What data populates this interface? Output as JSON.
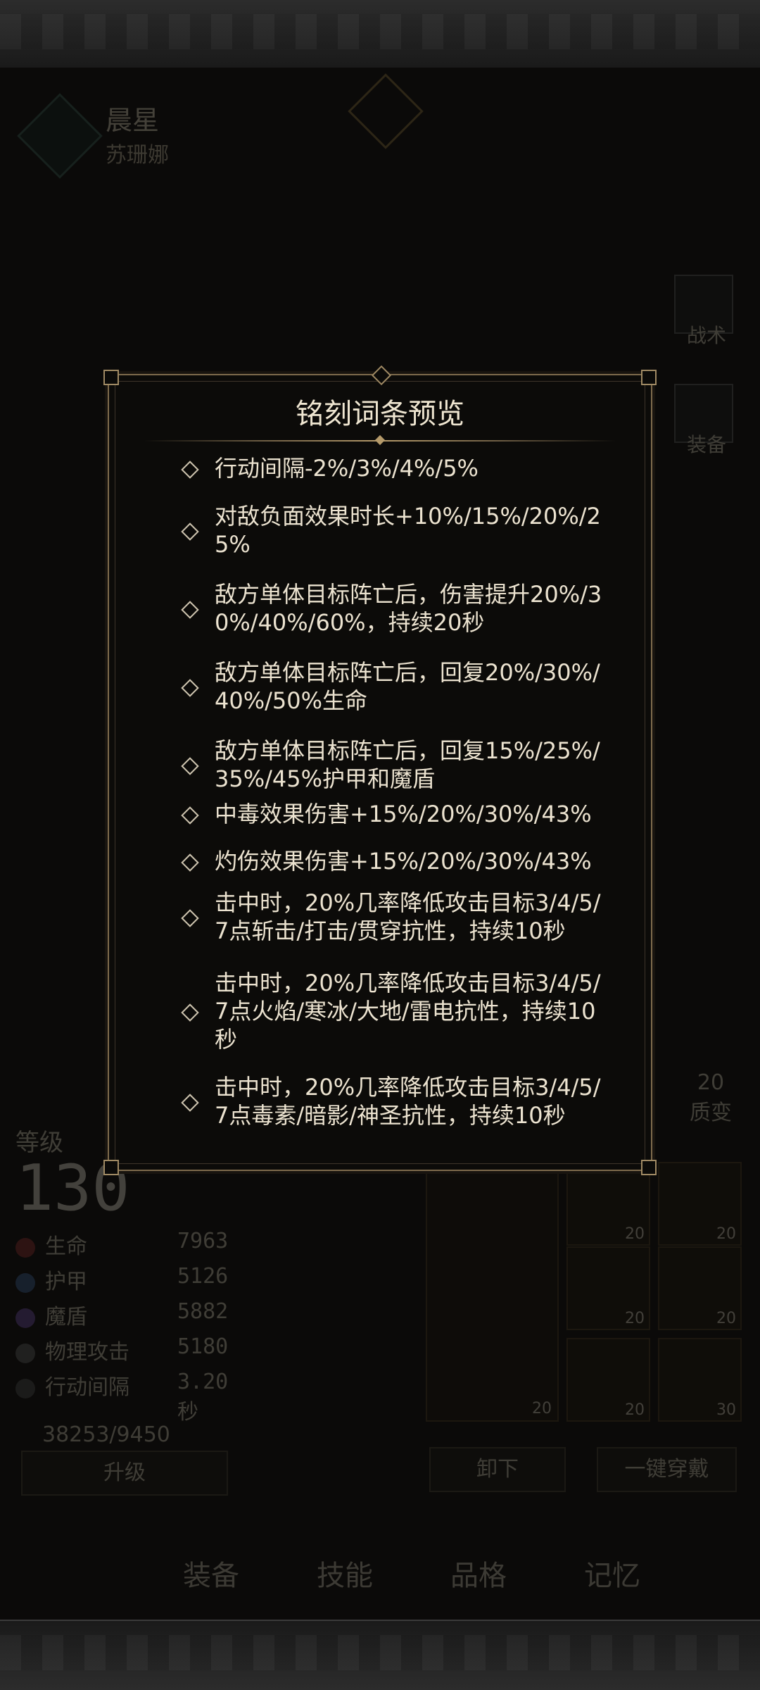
{
  "background": {
    "hero": {
      "title": "晨星",
      "name": "苏珊娜"
    },
    "side_buttons": [
      "战术",
      "装备"
    ],
    "stats": {
      "level_label": "等级",
      "level": "130",
      "rows": [
        {
          "label": "生命",
          "value": "7963"
        },
        {
          "label": "护甲",
          "value": "5126"
        },
        {
          "label": "魔盾",
          "value": "5882"
        },
        {
          "label": "物理攻击",
          "value": "5180"
        },
        {
          "label": "行动间隔",
          "value": "3.20秒"
        }
      ],
      "exp": "38253/9450"
    },
    "buttons": {
      "upgrade": "升级",
      "unequip": "卸下",
      "equip_all": "一键穿戴"
    },
    "quality": {
      "value": "20",
      "label": "质变"
    },
    "slots": [
      "20",
      "20",
      "20",
      "20",
      "20",
      "20",
      "30"
    ],
    "tabs": [
      "装备",
      "技能",
      "品格",
      "记忆"
    ]
  },
  "modal": {
    "title": "铭刻词条预览",
    "items": [
      "行动间隔-2%/3%/4%/5%",
      "对敌负面效果时长+10%/15%/20%/25%",
      "敌方单体目标阵亡后，伤害提升20%/30%/40%/60%，持续20秒",
      "敌方单体目标阵亡后，回复20%/30%/40%/50%生命",
      "敌方单体目标阵亡后，回复15%/25%/35%/45%护甲和魔盾",
      "中毒效果伤害+15%/20%/30%/43%",
      "灼伤效果伤害+15%/20%/30%/43%",
      "击中时，20%几率降低攻击目标3/4/5/7点斩击/打击/贯穿抗性，持续10秒",
      "击中时，20%几率降低攻击目标3/4/5/7点火焰/寒冰/大地/雷电抗性，持续10秒",
      "击中时，20%几率降低攻击目标3/4/5/7点毒素/暗影/神圣抗性，持续10秒"
    ]
  }
}
